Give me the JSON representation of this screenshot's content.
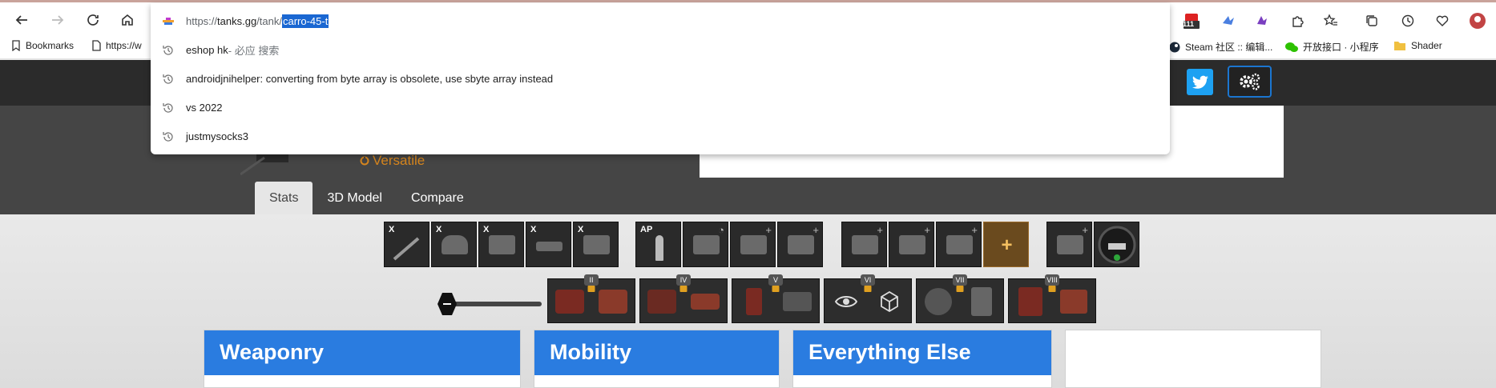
{
  "browser": {
    "omnibox": {
      "url_scheme": "https://",
      "url_domain": "tanks.gg",
      "url_path": "/tank/",
      "url_selected": "carro-45-t",
      "suggestions": [
        {
          "title": "eshop hk",
          "subtitle": " - 必应 搜索"
        },
        {
          "title": "androidjnihelper: converting from byte array is obsolete, use sbyte array instead",
          "subtitle": ""
        },
        {
          "title": "vs 2022",
          "subtitle": ""
        },
        {
          "title": "justmysocks3",
          "subtitle": ""
        }
      ]
    },
    "bookmarks": {
      "main": "Bookmarks",
      "truncated": "https://w",
      "steam": "Steam 社区 :: 编辑...",
      "wechat": "开放接口 · 小程序",
      "folder": "Shader"
    },
    "notification_badge": "111"
  },
  "page": {
    "playstyle": "Versatile",
    "tabs": [
      "Stats",
      "3D Model",
      "Compare"
    ],
    "module_tags": [
      "X",
      "X",
      "X",
      "X",
      "X"
    ],
    "ammo_tag": "AP",
    "crew_levels": [
      "II",
      "IV",
      "V",
      "VI",
      "VII",
      "VIII"
    ],
    "sections": [
      "Weaponry",
      "Mobility",
      "Everything Else"
    ],
    "colors": {
      "accent": "#2a7ce0",
      "twitter": "#1da1f2",
      "playstyle": "#d7861e"
    }
  }
}
